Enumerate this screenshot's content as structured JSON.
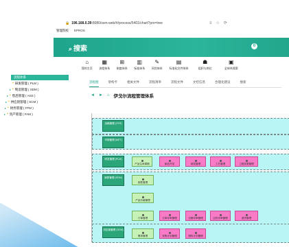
{
  "browser": {
    "url_prefix": "196.168.0.39",
    "url_rest": ":8080/ssm-web/#/process/5401/chart?pro=tree",
    "icons": [
      "≡",
      "☆",
      "⟳"
    ]
  },
  "bookmarks": [
    "管理院校",
    "EPROS"
  ],
  "app": {
    "title": "搜索",
    "title_icon": "search-icon",
    "settings_label": "0"
  },
  "toolbar": [
    {
      "icon": "home-icon",
      "glyph": "⌂",
      "label": "我的主页"
    },
    {
      "icon": "building-icon",
      "glyph": "▦",
      "label": "流程体系"
    },
    {
      "icon": "grid-icon",
      "glyph": "⊞",
      "label": "制度体系"
    },
    {
      "icon": "chart-icon",
      "glyph": "▥",
      "label": "标准体系"
    },
    {
      "icon": "pen-icon",
      "glyph": "✎",
      "label": "风险体系"
    },
    {
      "icon": "file-icon",
      "glyph": "▤",
      "label": "标准化文件体系"
    },
    {
      "icon": "people-icon",
      "glyph": "☗",
      "label": "组织与岗位"
    },
    {
      "icon": "clipboard-icon",
      "glyph": "▣",
      "label": "全体系搜索"
    }
  ],
  "sidebar": {
    "header": "流程体系",
    "items": [
      "研发管理 ( PLM )",
      "制造管理 ( SDM )",
      "售后管理 ( ASS )",
      "供应链管理 ( SCM )",
      "财务管理 ( FFM )",
      "资产管理 ( FAM )"
    ]
  },
  "tabs": [
    "流程图",
    "架构卡",
    "相关文件",
    "流程清单",
    "流程文件",
    "文控信息",
    "合理化建议",
    "搜索"
  ],
  "breadcrumb": {
    "title": "伊戈尔流程管理体系",
    "nav_icons": [
      "◄",
      "►",
      "⌂"
    ]
  },
  "diagram": {
    "lanes": [
      {
        "label": "战略管理 (STR)"
      },
      {
        "label": "市场管理 (MKT)"
      },
      {
        "label": "研发管理 (PLM)"
      },
      {
        "label": "销售管理 (SDM)"
      },
      {
        "label": ""
      },
      {
        "label": ""
      },
      {
        "label": "供应链管理 (SCM)"
      }
    ],
    "nodes": [
      {
        "text": "产品生命周期",
        "style": "green"
      },
      {
        "text": "新品开发",
        "style": "pink"
      },
      {
        "text": "研发管理",
        "style": "pink"
      },
      {
        "text": "工艺管理",
        "style": "pink"
      },
      {
        "text": "工程变更管理",
        "style": "pink"
      },
      {
        "text": "销售管理",
        "style": "green"
      },
      {
        "text": "产品价格管理",
        "style": "green"
      },
      {
        "text": "订单管理",
        "style": "green"
      },
      {
        "text": "订单评审管理",
        "style": "pink"
      },
      {
        "text": "交期评审管理",
        "style": "pink"
      },
      {
        "text": "出货评审管理",
        "style": "pink"
      },
      {
        "text": "退货管理",
        "style": "pink"
      },
      {
        "text": "需求管理",
        "style": "green"
      },
      {
        "text": "采购计划管理",
        "style": "pink"
      },
      {
        "text": "物料计划管理",
        "style": "pink"
      }
    ]
  }
}
